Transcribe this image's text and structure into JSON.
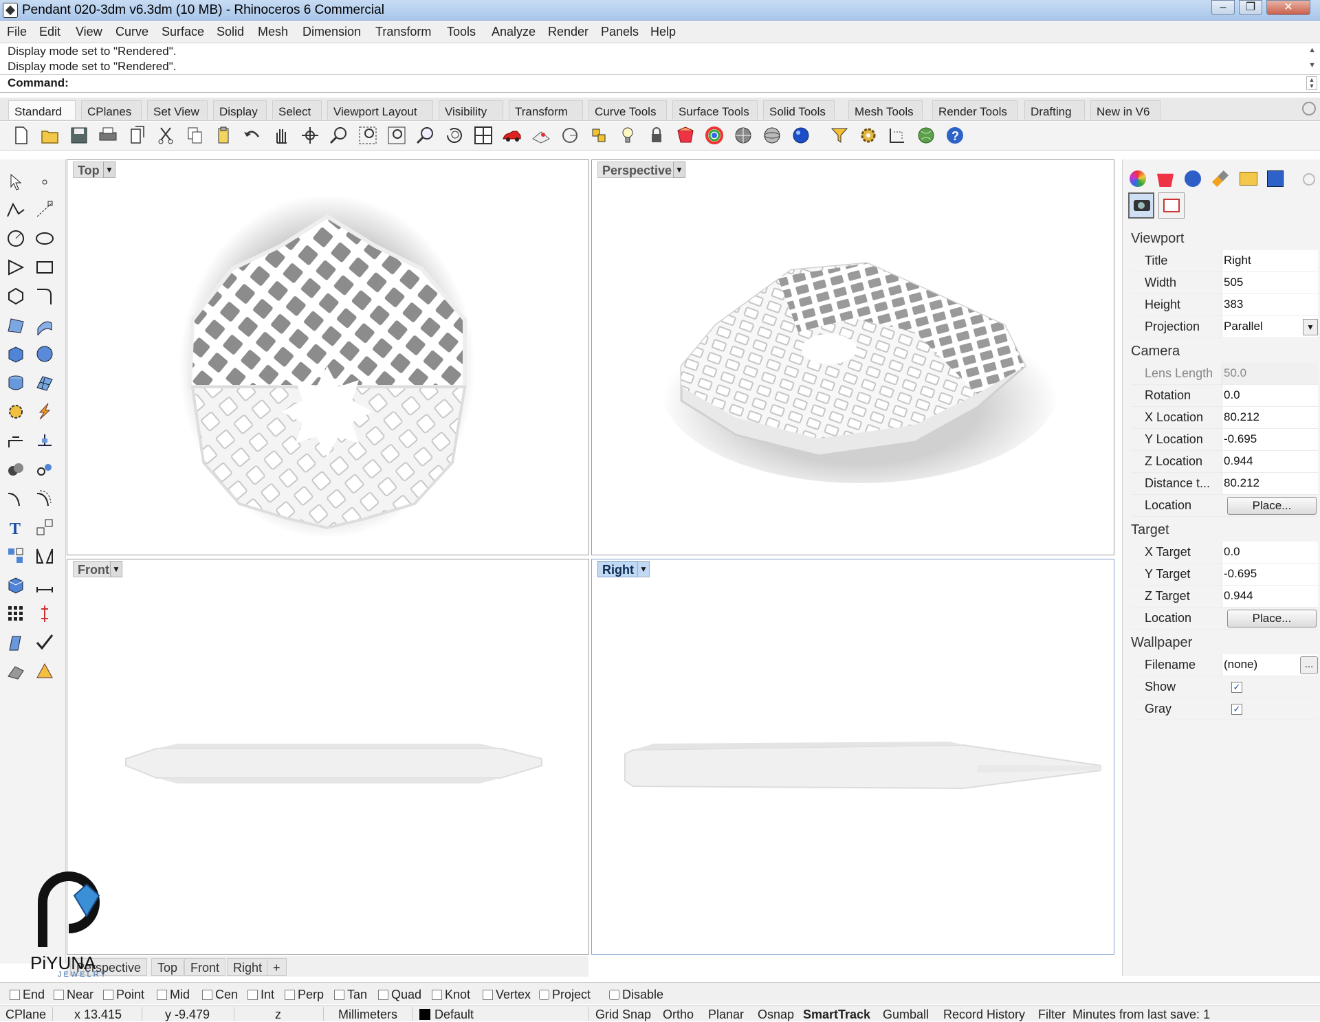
{
  "window": {
    "title": "Pendant 020-3dm v6.3dm (10 MB) - Rhinoceros 6 Commercial",
    "minimize": "‒",
    "maximize": "❐",
    "close": "✕"
  },
  "menu": [
    "File",
    "Edit",
    "View",
    "Curve",
    "Surface",
    "Solid",
    "Mesh",
    "Dimension",
    "Transform",
    "Tools",
    "Analyze",
    "Render",
    "Panels",
    "Help"
  ],
  "command_history": [
    "Display mode set to \"Rendered\".",
    "Display mode set to \"Rendered\"."
  ],
  "command_prompt": "Command:",
  "toolbar_tabs": [
    "Standard",
    "CPlanes",
    "Set View",
    "Display",
    "Select",
    "Viewport Layout",
    "Visibility",
    "Transform",
    "Curve Tools",
    "Surface Tools",
    "Solid Tools",
    "Mesh Tools",
    "Render Tools",
    "Drafting",
    "New in V6"
  ],
  "toolbar_icons": [
    "new-file",
    "open-file",
    "save",
    "print",
    "import",
    "cut",
    "copy",
    "paste",
    "undo",
    "pan",
    "rotate-view",
    "zoom",
    "zoom-window",
    "zoom-extents",
    "zoom-selected",
    "rotate-camera",
    "four-viewports",
    "car-render",
    "grid",
    "cplane",
    "snap-points",
    "light",
    "lock",
    "layer",
    "color-wheel",
    "material-sphere",
    "environment",
    "render-sphere",
    "filter",
    "options",
    "dimension",
    "globe",
    "help"
  ],
  "viewports": {
    "top": {
      "label": "Top"
    },
    "perspective": {
      "label": "Perspective"
    },
    "front": {
      "label": "Front"
    },
    "right": {
      "label": "Right"
    }
  },
  "viewport_tabs": [
    "Perspective",
    "Top",
    "Front",
    "Right",
    "+"
  ],
  "panel": {
    "viewport_heading": "Viewport",
    "viewport": [
      {
        "label": "Title",
        "value": "Right"
      },
      {
        "label": "Width",
        "value": "505"
      },
      {
        "label": "Height",
        "value": "383"
      },
      {
        "label": "Projection",
        "value": "Parallel"
      }
    ],
    "camera_heading": "Camera",
    "camera": [
      {
        "label": "Lens Length",
        "value": "50.0"
      },
      {
        "label": "Rotation",
        "value": "0.0"
      },
      {
        "label": "X Location",
        "value": "80.212"
      },
      {
        "label": "Y Location",
        "value": "-0.695"
      },
      {
        "label": "Z Location",
        "value": "0.944"
      },
      {
        "label": "Distance t...",
        "value": "80.212"
      },
      {
        "label": "Location",
        "button": "Place..."
      }
    ],
    "target_heading": "Target",
    "target": [
      {
        "label": "X Target",
        "value": "0.0"
      },
      {
        "label": "Y Target",
        "value": "-0.695"
      },
      {
        "label": "Z Target",
        "value": "0.944"
      },
      {
        "label": "Location",
        "button": "Place..."
      }
    ],
    "wallpaper_heading": "Wallpaper",
    "wallpaper": [
      {
        "label": "Filename",
        "value": "(none)",
        "button": "..."
      },
      {
        "label": "Show",
        "checked": "✓"
      },
      {
        "label": "Gray",
        "checked": "✓"
      }
    ]
  },
  "osnaps": [
    "End",
    "Near",
    "Point",
    "Mid",
    "Cen",
    "Int",
    "Perp",
    "Tan",
    "Quad",
    "Knot",
    "Vertex",
    "Project",
    "Disable"
  ],
  "status": {
    "cplane": "CPlane",
    "x": "x 13.415",
    "y": "y -9.479",
    "z": "z",
    "units": "Millimeters",
    "layer": "Default",
    "toggles": [
      "Grid Snap",
      "Ortho",
      "Planar",
      "Osnap",
      "SmartTrack",
      "Gumball",
      "Record History",
      "Filter"
    ],
    "save_info": "Minutes from last save: 1"
  },
  "logo": {
    "text": "PiYUNA",
    "subtext": "JEWELRY"
  },
  "colors": {
    "accent": "#c2d9f3",
    "titlebar": "#a9c6ea",
    "panel_bg": "#f3f3f3"
  }
}
